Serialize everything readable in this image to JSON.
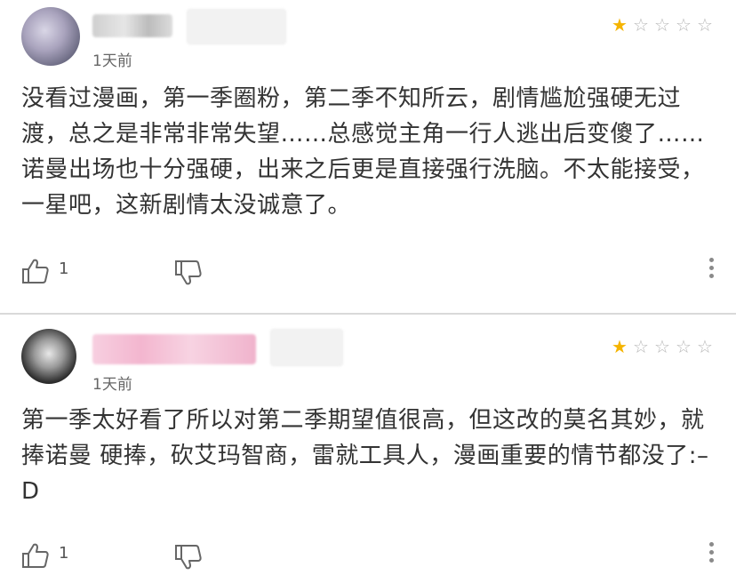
{
  "reviews": [
    {
      "time": "1天前",
      "rating": 1,
      "max_rating": 5,
      "content": "没看过漫画，第一季圈粉，第二季不知所云，剧情尴尬强硬无过渡，总之是非常非常失望……总感觉主角一行人逃出后变傻了……诺曼出场也十分强硬，出来之后更是直接强行洗脑。不太能接受，一星吧，这新剧情太没诚意了。",
      "likes": "1"
    },
    {
      "time": "1天前",
      "rating": 1,
      "max_rating": 5,
      "content": "第一季太好看了所以对第二季期望值很高，但这改的莫名其妙，就捧诺曼  硬捧，砍艾玛智商，雷就工具人，漫画重要的情节都没了:–D",
      "likes": "1"
    }
  ],
  "colors": {
    "star_on": "#f5b400",
    "star_off": "#b8b8b8",
    "text": "#333333",
    "meta": "#666666"
  },
  "icons": [
    "thumbs-up-icon",
    "thumbs-down-icon",
    "more-vertical-icon",
    "star-icon"
  ]
}
